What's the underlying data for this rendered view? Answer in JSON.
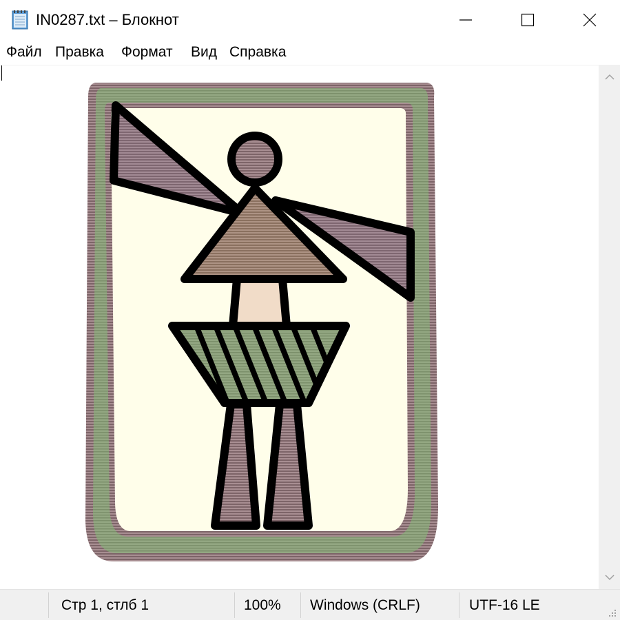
{
  "window": {
    "title": "IN0287.txt – Блокнот"
  },
  "icons": {
    "app": "notepad-icon",
    "minimize": "minimize-icon",
    "maximize": "maximize-icon",
    "close": "close-icon",
    "scroll_up": "chevron-up-icon",
    "scroll_down": "chevron-down-icon",
    "grip": "resize-grip-icon"
  },
  "menu": {
    "items": [
      "Файл",
      "Правка",
      "Формат",
      "Вид",
      "Справка"
    ]
  },
  "status": {
    "position": "Стр 1, стлб 1",
    "zoom": "100%",
    "line_endings": "Windows (CRLF)",
    "encoding": "UTF-16 LE"
  },
  "colors": {
    "frame_mauve": "#9a8386",
    "frame_green": "#8b9f79",
    "background_cream": "#fffeea",
    "figure_brown": "#a08778",
    "figure_peach": "#f1dcc8",
    "outline": "#000000"
  }
}
